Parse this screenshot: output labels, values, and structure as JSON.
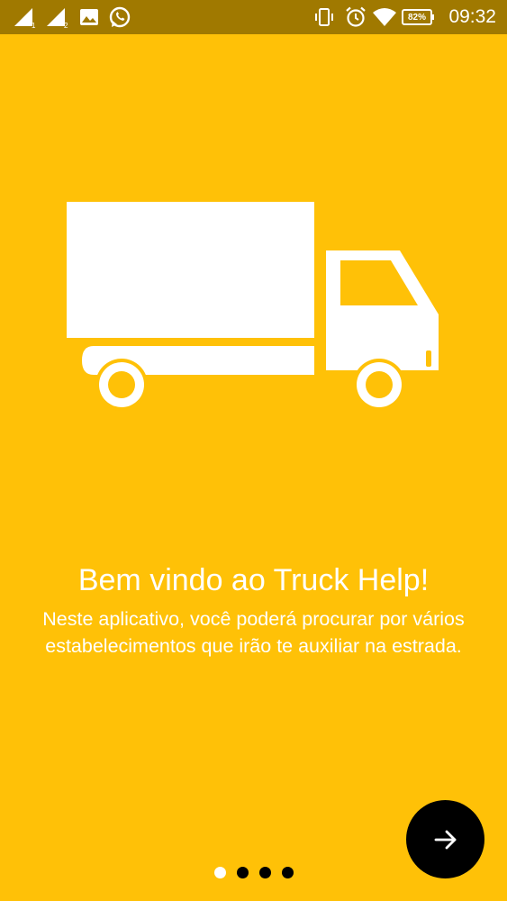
{
  "status_bar": {
    "time": "09:32",
    "battery": "82%",
    "sim1_label": "1",
    "sim2_label": "2",
    "icons": [
      "signal-sim1-icon",
      "signal-sim2-icon",
      "image-notification-icon",
      "whatsapp-icon",
      "vibrate-icon",
      "alarm-icon",
      "wifi-icon",
      "battery-icon"
    ]
  },
  "onboarding": {
    "illustration": "truck-icon",
    "title": "Bem vindo ao Truck Help!",
    "description_line1": "Neste aplicativo, você poderá procurar por vários",
    "description_line2": "estabelecimentos que irão te auxiliar na estrada.",
    "next_icon": "arrow-right-icon",
    "page_count": 4,
    "current_page": 1
  },
  "colors": {
    "background": "#FFC107",
    "status_bar": "#A07900",
    "fab": "#000000",
    "text": "#FFFFFF",
    "dot_active": "#FFFFFF",
    "dot_inactive": "#000000"
  }
}
